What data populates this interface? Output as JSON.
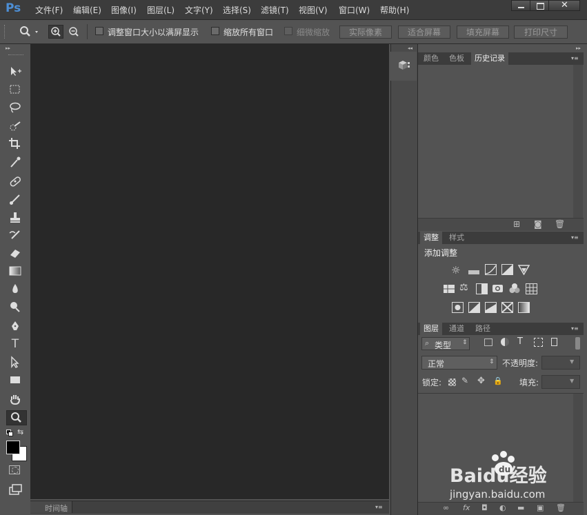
{
  "app": {
    "logo": "Ps"
  },
  "menu": [
    "文件(F)",
    "编辑(E)",
    "图像(I)",
    "图层(L)",
    "文字(Y)",
    "选择(S)",
    "滤镜(T)",
    "视图(V)",
    "窗口(W)",
    "帮助(H)"
  ],
  "window_controls": [
    "minimize",
    "maximize",
    "close"
  ],
  "options": {
    "resize_windows_label": "调整窗口大小以满屏显示",
    "zoom_all_label": "缩放所有窗口",
    "scrubby_zoom_label": "细微缩放",
    "actual_pixels": "实际像素",
    "fit_screen": "适合屏幕",
    "fill_screen": "填充屏幕",
    "print_size": "打印尺寸"
  },
  "timeline": {
    "label": "时间轴"
  },
  "panels": {
    "top": {
      "tabs": [
        "颜色",
        "色板",
        "历史记录"
      ],
      "active": 2
    },
    "adjust": {
      "tabs": [
        "调整",
        "样式"
      ],
      "active": 0,
      "title": "添加调整"
    },
    "layers": {
      "tabs": [
        "图层",
        "通道",
        "路径"
      ],
      "active": 0,
      "filter_kind": "类型",
      "blend_mode": "正常",
      "opacity_label": "不透明度:",
      "lock_label": "锁定:",
      "fill_label": "填充:"
    }
  },
  "watermark": {
    "brand": "Baidu经验",
    "url": "jingyan.baidu.com"
  }
}
